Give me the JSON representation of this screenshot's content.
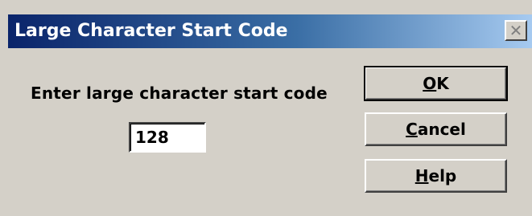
{
  "dialog": {
    "title": "Large Character Start Code",
    "close_glyph": "✕",
    "close_icon": "close-icon"
  },
  "form": {
    "prompt_label": "Enter large character start code",
    "start_code_value": "128"
  },
  "buttons": {
    "ok": {
      "mnemonic": "O",
      "rest": "K"
    },
    "cancel": {
      "mnemonic": "C",
      "rest": "ancel"
    },
    "help": {
      "mnemonic": "H",
      "rest": "elp"
    }
  },
  "colors": {
    "title_bar_start": "#0a246a",
    "title_bar_end": "#a6caf0",
    "dialog_face": "#d4d0c8"
  }
}
